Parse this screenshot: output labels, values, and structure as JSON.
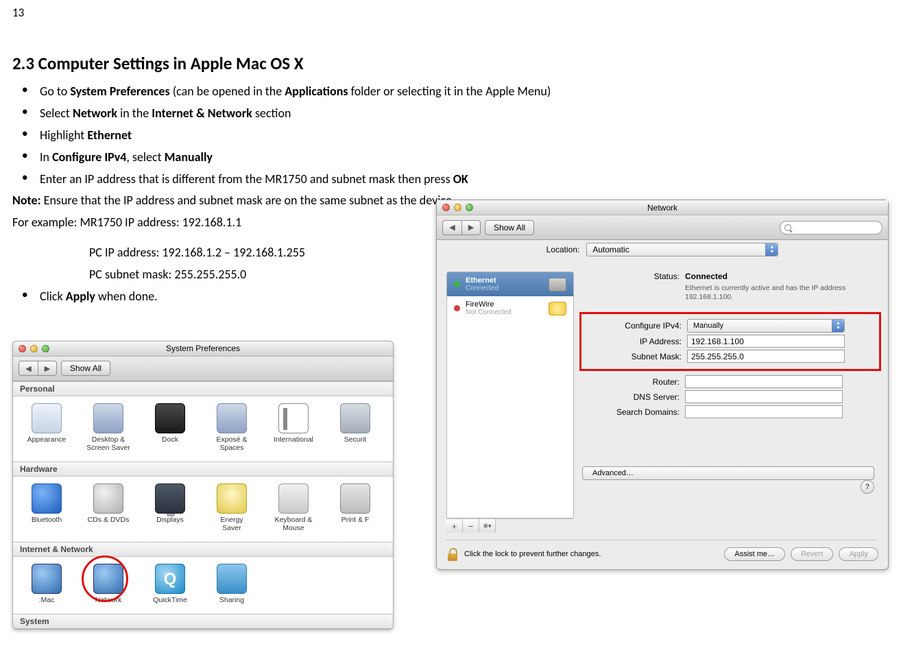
{
  "page_number": "13",
  "heading": "2.3   Computer Settings in Apple Mac OS X",
  "bullets": {
    "b1_pre": "Go to ",
    "b1_bold1": "System Preferences",
    "b1_mid": " (can be opened in the ",
    "b1_bold2": "Applications",
    "b1_post": " folder or selecting it in the Apple Menu)",
    "b2_pre": "Select ",
    "b2_bold1": "Network",
    "b2_mid": " in the ",
    "b2_bold2": "Internet & Network",
    "b2_post": " section",
    "b3_pre": "Highlight ",
    "b3_bold": "Ethernet",
    "b4_pre": "In ",
    "b4_bold1": "Configure IPv4",
    "b4_mid": ", select ",
    "b4_bold2": "Manually",
    "b5_pre": "Enter an IP address that is different from the MR1750 and subnet mask then press ",
    "b5_bold": "OK",
    "b6_pre": "Click ",
    "b6_bold": "Apply",
    "b6_post": " when done."
  },
  "note_bold": "Note:",
  "note_text": " Ensure that the IP address and subnet mask are on the same subnet as the device.",
  "example_label": "For example:",
  "example_l1": " MR1750 IP address: 192.168.1.1",
  "example_l2": "PC IP address: 192.168.1.2 – 192.168.1.255",
  "example_l3": "PC subnet mask: 255.255.255.0",
  "sp": {
    "title": "System Preferences",
    "show_all": "Show All",
    "sections": {
      "personal": "Personal",
      "hardware": "Hardware",
      "internet": "Internet & Network",
      "system": "System"
    },
    "icons": {
      "appearance": "Appearance",
      "desktop": "Desktop &\nScreen Saver",
      "dock": "Dock",
      "expose": "Exposé &\nSpaces",
      "intl": "International",
      "security": "Securit",
      "bluetooth": "Bluetooth",
      "cds": "CDs & DVDs",
      "displays": "Displays",
      "energy": "Energy\nSaver",
      "keyboard": "Keyboard &\nMouse",
      "print": "Print & F",
      "mac": ".Mac",
      "network": "Network",
      "quicktime": "QuickTime",
      "sharing": "Sharing"
    }
  },
  "net": {
    "title": "Network",
    "show_all": "Show All",
    "location_label": "Location:",
    "location_value": "Automatic",
    "sidebar": {
      "ethernet": "Ethernet",
      "ethernet_sub": "Connected",
      "firewire": "FireWire",
      "firewire_sub": "Not Connected"
    },
    "status_label": "Status:",
    "status_value": "Connected",
    "status_desc": "Ethernet is currently active and has the IP address 192.168.1.100.",
    "fields": {
      "configure_label": "Configure IPv4:",
      "configure_value": "Manually",
      "ip_label": "IP Address:",
      "ip_value": "192.168.1.100",
      "mask_label": "Subnet Mask:",
      "mask_value": "255.255.255.0",
      "router_label": "Router:",
      "router_value": "",
      "dns_label": "DNS Server:",
      "dns_value": "",
      "search_label": "Search Domains:",
      "search_value": ""
    },
    "advanced": "Advanced…",
    "help": "?",
    "lock_text": "Click the lock to prevent further changes.",
    "assist": "Assist me…",
    "revert": "Revert",
    "apply": "Apply",
    "plus": "+",
    "minus": "−",
    "gear": "✻▾"
  },
  "nav": {
    "back": "◀",
    "fwd": "▶"
  }
}
